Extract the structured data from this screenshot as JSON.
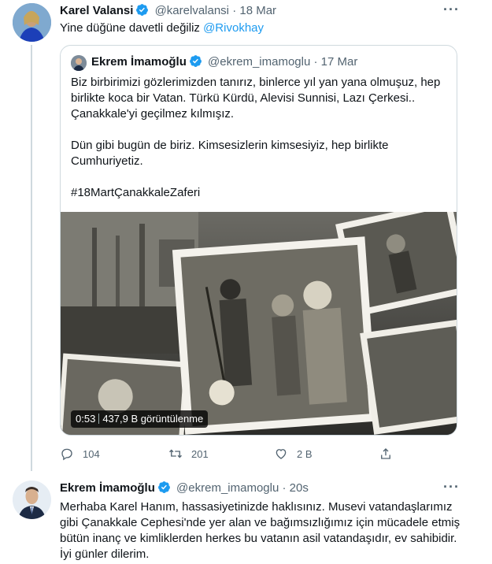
{
  "tweet": {
    "author_name": "Karel Valansi",
    "handle": "@karelvalansi",
    "separator": "·",
    "date": "18 Mar",
    "text_prefix": "Yine düğüne davetli değiliz ",
    "mention": "@Rivokhay",
    "more": "···",
    "avatar_icon": "profile-photo",
    "verified_icon": "verified-badge-icon"
  },
  "quoted": {
    "author_name": "Ekrem İmamoğlu",
    "handle": "@ekrem_imamoglu",
    "separator": "·",
    "date": "17 Mar",
    "paragraphs": [
      "Biz birbirimizi gözlerimizden tanırız, binlerce yıl yan yana olmuşuz, hep birlikte koca bir Vatan. Türkü Kürdü, Alevisi Sunnisi, Lazı Çerkesi.. Çanakkale'yi geçilmez kılmışız.",
      "Dün gibi bugün de biriz. Kimsesizlerin kimsesiyiz, hep birlikte Cumhuriyetiz.",
      "#18MartÇanakkaleZaferi"
    ],
    "video": {
      "duration": "0:53",
      "views": "437,9 B görüntülenme"
    }
  },
  "actions": {
    "replies": "104",
    "retweets": "201",
    "likes": "2 B"
  },
  "reply": {
    "author_name": "Ekrem İmamoğlu",
    "handle": "@ekrem_imamoglu",
    "separator": "·",
    "date": "20s",
    "more": "···",
    "text": "Merhaba Karel Hanım, hassasiyetinizde haklısınız. Musevi vatandaşlarımız gibi Çanakkale Cephesi'nde yer alan ve bağımsızlığımız için mücadele etmiş bütün inanç ve kimliklerden herkes bu vatanın asil vatandaşıdır, ev sahibidir. İyi günler dilerim."
  },
  "colors": {
    "accent": "#1d9bf0",
    "muted": "#536471",
    "border": "#cfd9de"
  }
}
